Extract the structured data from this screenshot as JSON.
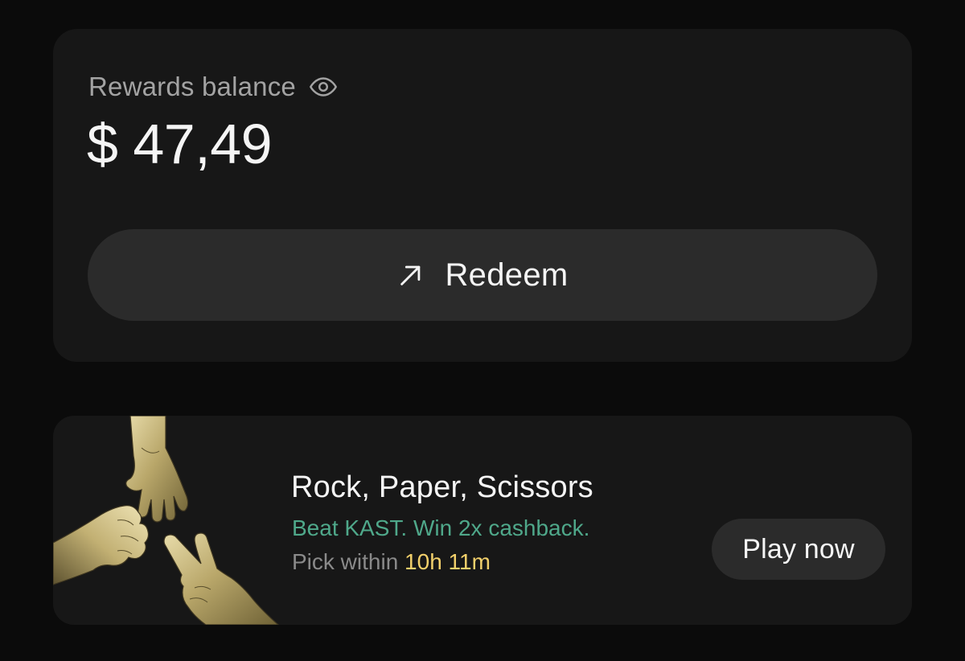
{
  "rewards": {
    "label": "Rewards balance",
    "visibility_icon": "eye-icon",
    "balance": "$ 47,49",
    "redeem_label": "Redeem",
    "redeem_icon": "arrow-up-right-icon"
  },
  "game": {
    "title": "Rock, Paper, Scissors",
    "tagline": "Beat KAST. Win 2x cashback.",
    "pick_label": "Pick within ",
    "pick_time": "10h 11m",
    "play_label": "Play now",
    "art": "gold-hands-rock-paper-scissors"
  },
  "colors": {
    "background": "#0b0b0b",
    "card": "#171717",
    "button": "#2b2b2b",
    "tagline_green": "#4fa88a",
    "timer_yellow": "#f2d06b"
  }
}
